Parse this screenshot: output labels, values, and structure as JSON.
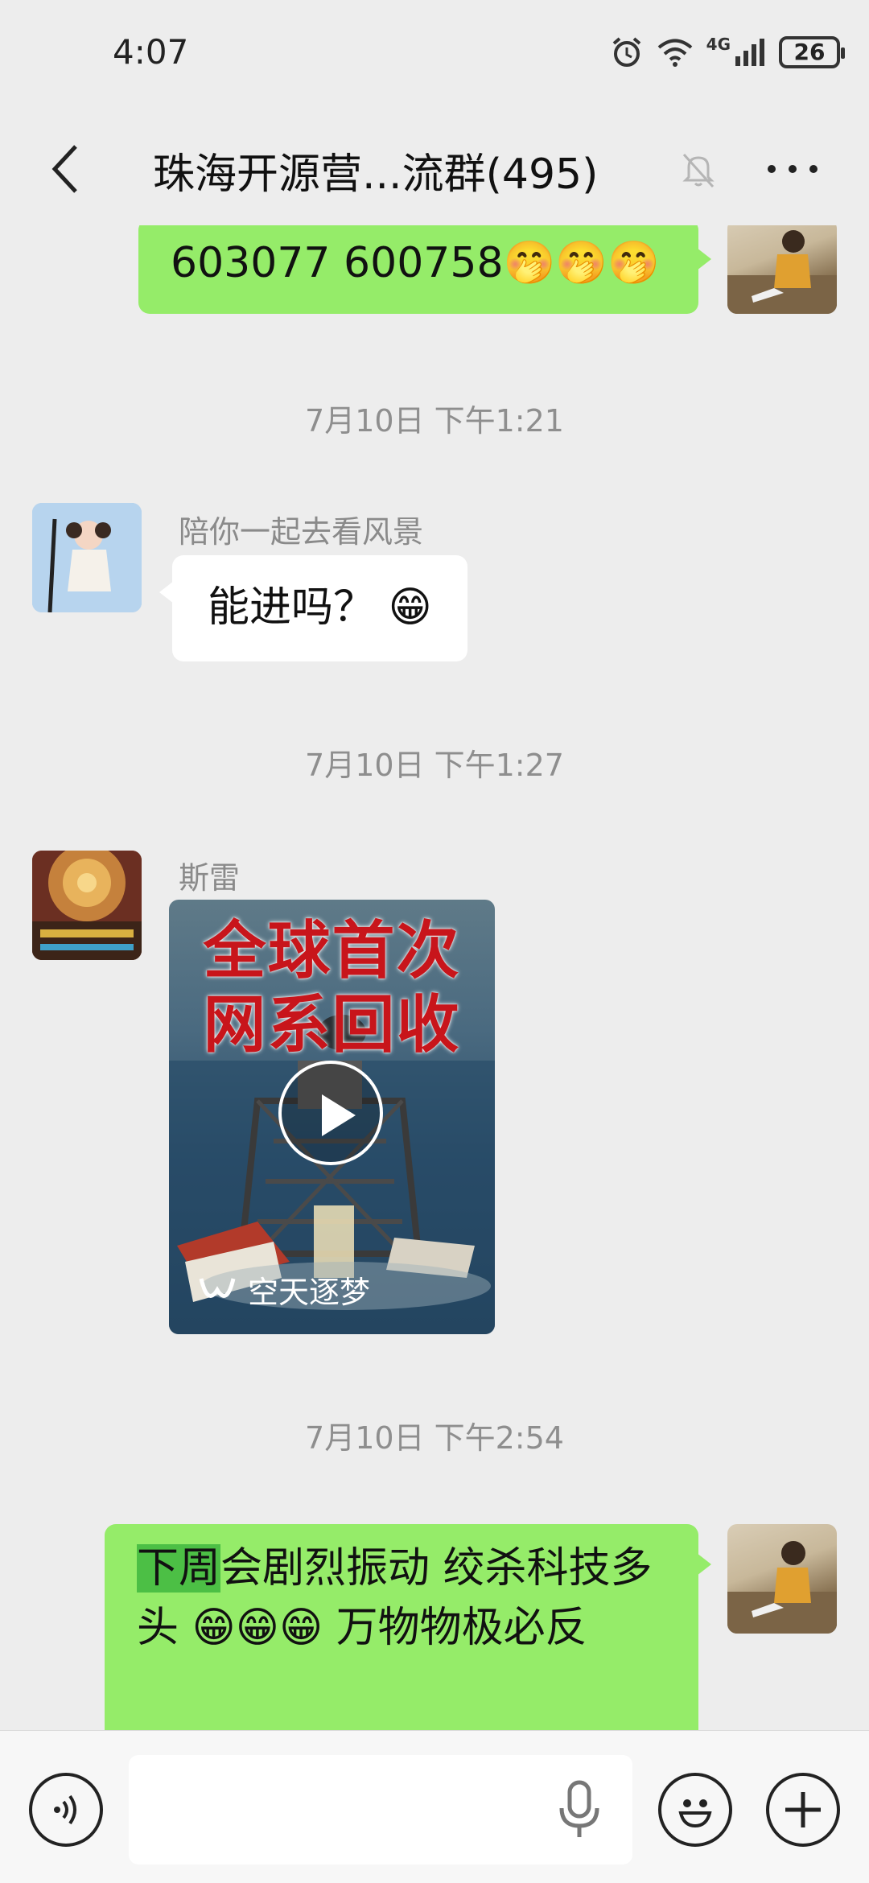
{
  "status_bar": {
    "time": "4:07",
    "network": "4G",
    "battery": "26"
  },
  "header": {
    "title": "珠海开源营...流群(495)"
  },
  "messages": {
    "m0": {
      "text": "603077  600758🤭🤭🤭"
    },
    "t1": "7月10日 下午1:21",
    "m1": {
      "sender": "陪你一起去看风景",
      "text": "能进吗？ 😁"
    },
    "t2": "7月10日 下午1:27",
    "m2": {
      "sender": "斯雷",
      "video_title_1": "全球首次",
      "video_title_2": "网系回收",
      "video_channel": "空天逐梦"
    },
    "t3": "7月10日 下午2:54",
    "m3": {
      "highlight": "下周",
      "text": "会剧烈振动  绞杀科技多头 😁😁😁  万物物极必反"
    }
  },
  "icons": {
    "back": "chevron-left-icon",
    "mute": "bell-off-icon",
    "more": "more-icon",
    "voice": "voice-icon",
    "mic": "mic-icon",
    "emoji": "emoji-icon",
    "plus": "plus-icon"
  },
  "colors": {
    "bubble_self": "#95ec69",
    "bubble_other": "#ffffff",
    "background": "#ededed",
    "highlight": "#4cbf45"
  }
}
